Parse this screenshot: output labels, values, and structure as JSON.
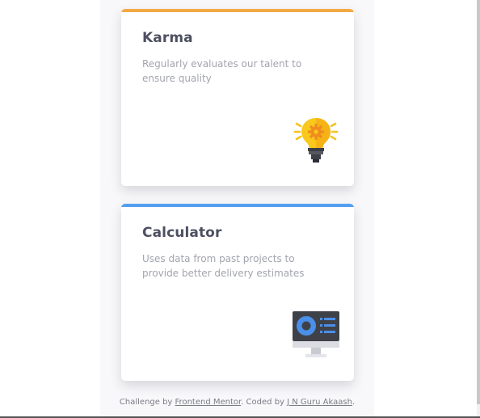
{
  "colors": {
    "karma_accent": "#f4a944",
    "calculator_accent": "#549ef2",
    "title_text": "#4d5061",
    "body_text": "#a3a5ae"
  },
  "cards": [
    {
      "title": "Karma",
      "description": "Regularly evaluates our talent to ensure quality",
      "icon": "lightbulb-icon"
    },
    {
      "title": "Calculator",
      "description": "Uses data from past projects to provide better delivery estimates",
      "icon": "computer-monitor-icon"
    }
  ],
  "footer": {
    "prefix": "Challenge by ",
    "link1": "Frontend Mentor",
    "middle": ". Coded by ",
    "link2": "J N Guru Akaash",
    "suffix": "."
  }
}
